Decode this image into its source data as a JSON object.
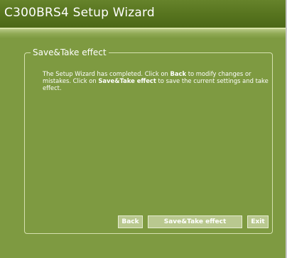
{
  "window": {
    "title": "C300BRS4 Setup Wizard"
  },
  "section": {
    "legend": "Save&Take effect"
  },
  "message": {
    "part1": "The Setup Wizard has completed. Click on ",
    "back_word": "Back",
    "part2": " to modify changes or mistakes. Click on ",
    "save_word": "Save&Take effect",
    "part3": " to save the current settings and take effect."
  },
  "buttons": {
    "back": "Back",
    "save": "Save&Take effect",
    "exit": "Exit"
  },
  "colors": {
    "background": "#7e9a41",
    "titlebar": "#56731e",
    "button": "#b9c88f",
    "text": "#ffffff"
  }
}
